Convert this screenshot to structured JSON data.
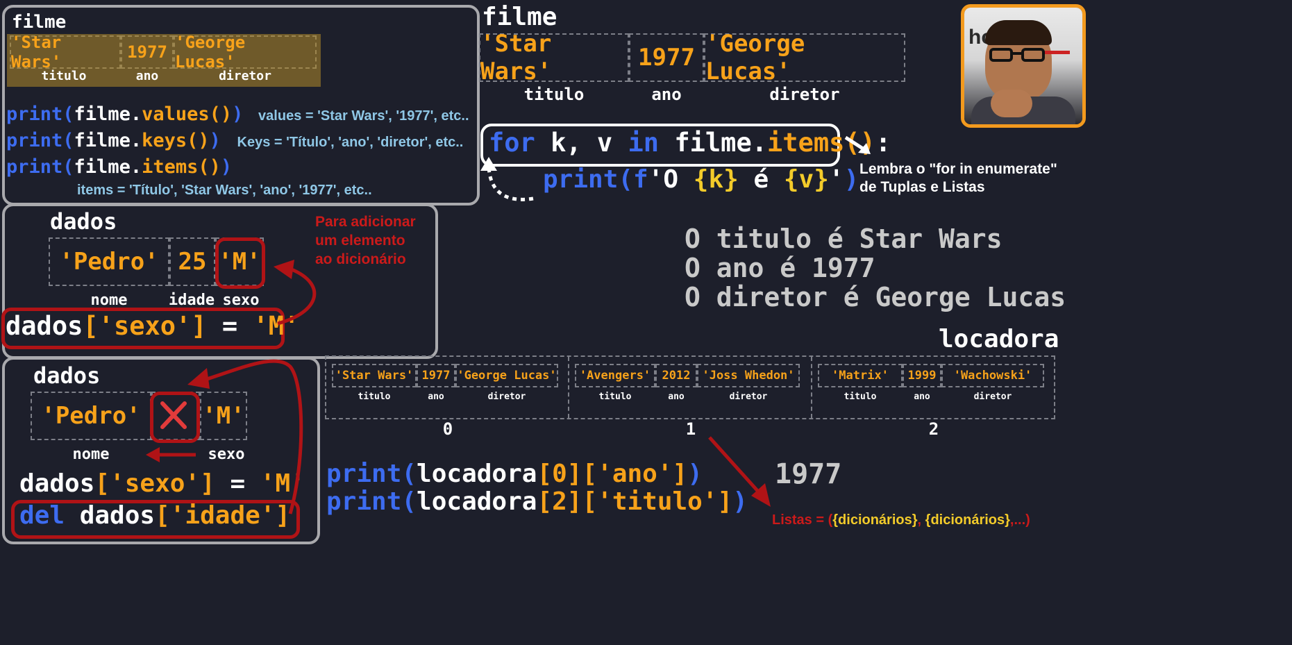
{
  "panel1": {
    "title": "filme",
    "values": [
      "'Star Wars'",
      "1977",
      "'George Lucas'"
    ],
    "labels": [
      "titulo",
      "ano",
      "diretor"
    ],
    "code": [
      {
        "fn": "print(",
        "obj": "filme",
        "dot": ".",
        "method": "values()",
        "close": ")",
        "note": "values = 'Star Wars', '1977', etc.."
      },
      {
        "fn": "print(",
        "obj": "filme",
        "dot": ".",
        "method": "keys()",
        "close": ")",
        "note": "Keys = 'Título', 'ano', 'diretor', etc.."
      },
      {
        "fn": "print(",
        "obj": "filme",
        "dot": ".",
        "method": "items()",
        "close": ")",
        "note": ""
      }
    ],
    "items_note": "items = 'Título', 'Star Wars', 'ano', '1977', etc.."
  },
  "main": {
    "title": "filme",
    "values": [
      "'Star Wars'",
      "1977",
      "'George Lucas'"
    ],
    "labels": [
      "titulo",
      "ano",
      "diretor"
    ],
    "for_line": {
      "kw_for": "for",
      "vars": "k, v",
      "kw_in": "in",
      "obj": "filme",
      "dot": ".",
      "method": "items()",
      "colon": ":"
    },
    "print_line": {
      "fn": "print(",
      "f": "f",
      "q1": "'",
      "text": "O ",
      "k": "{k}",
      "e": " é ",
      "v": "{v}",
      "q2": "'",
      "close": ")"
    },
    "reminder": [
      "Lembra o \"for in enumerate\"",
      "de Tuplas e Listas"
    ],
    "output": [
      "O titulo é Star Wars",
      "O ano é 1977",
      "O diretor é George Lucas"
    ]
  },
  "panel2": {
    "title": "dados",
    "values": [
      "'Pedro'",
      "25",
      "'M'"
    ],
    "labels": [
      "nome",
      "idade",
      "sexo"
    ],
    "note": [
      "Para adicionar",
      "um elemento",
      "ao dicionário"
    ],
    "code": {
      "obj": "dados",
      "key": "['sexo']",
      "eq": " = ",
      "val": "'M'"
    }
  },
  "panel3": {
    "title": "dados",
    "values": [
      "'Pedro'",
      "'M'"
    ],
    "labels": [
      "nome",
      "sexo"
    ],
    "code1": {
      "obj": "dados",
      "key": "['sexo']",
      "eq": " = ",
      "val": "'M'"
    },
    "code2": {
      "kw": "del",
      "obj": " dados",
      "key": "['idade']"
    }
  },
  "locadora": {
    "title": "locadora",
    "records": [
      {
        "values": [
          "'Star Wars'",
          "1977",
          "'George Lucas'"
        ],
        "labels": [
          "titulo",
          "ano",
          "diretor"
        ],
        "index": "0"
      },
      {
        "values": [
          "'Avengers'",
          "2012",
          "'Joss Whedon'"
        ],
        "labels": [
          "titulo",
          "ano",
          "diretor"
        ],
        "index": "1"
      },
      {
        "values": [
          "'Matrix'",
          "1999",
          "'Wachowski'"
        ],
        "labels": [
          "titulo",
          "ano",
          "diretor"
        ],
        "index": "2"
      }
    ],
    "code": [
      {
        "fn": "print(",
        "obj": "locadora",
        "idx": "[0]",
        "key": "['ano']",
        "close": ")"
      },
      {
        "fn": "print(",
        "obj": "locadora",
        "idx": "[2]",
        "key": "['titulo']",
        "close": ")"
      }
    ],
    "result": "1977",
    "footer": {
      "a": "Listas = (",
      "b": "{dicionários}",
      "c": ", ",
      "d": "{dicionários}",
      "e": ",...)"
    }
  },
  "colors": {
    "background": "#1d1f2b",
    "orange": "#f7a21a",
    "blue": "#3d6cf0",
    "red": "#cc1a1a",
    "yellow": "#f3cb2a",
    "webcam_border": "#f39a1e"
  },
  "webcam": {
    "logo_text": "ho"
  }
}
